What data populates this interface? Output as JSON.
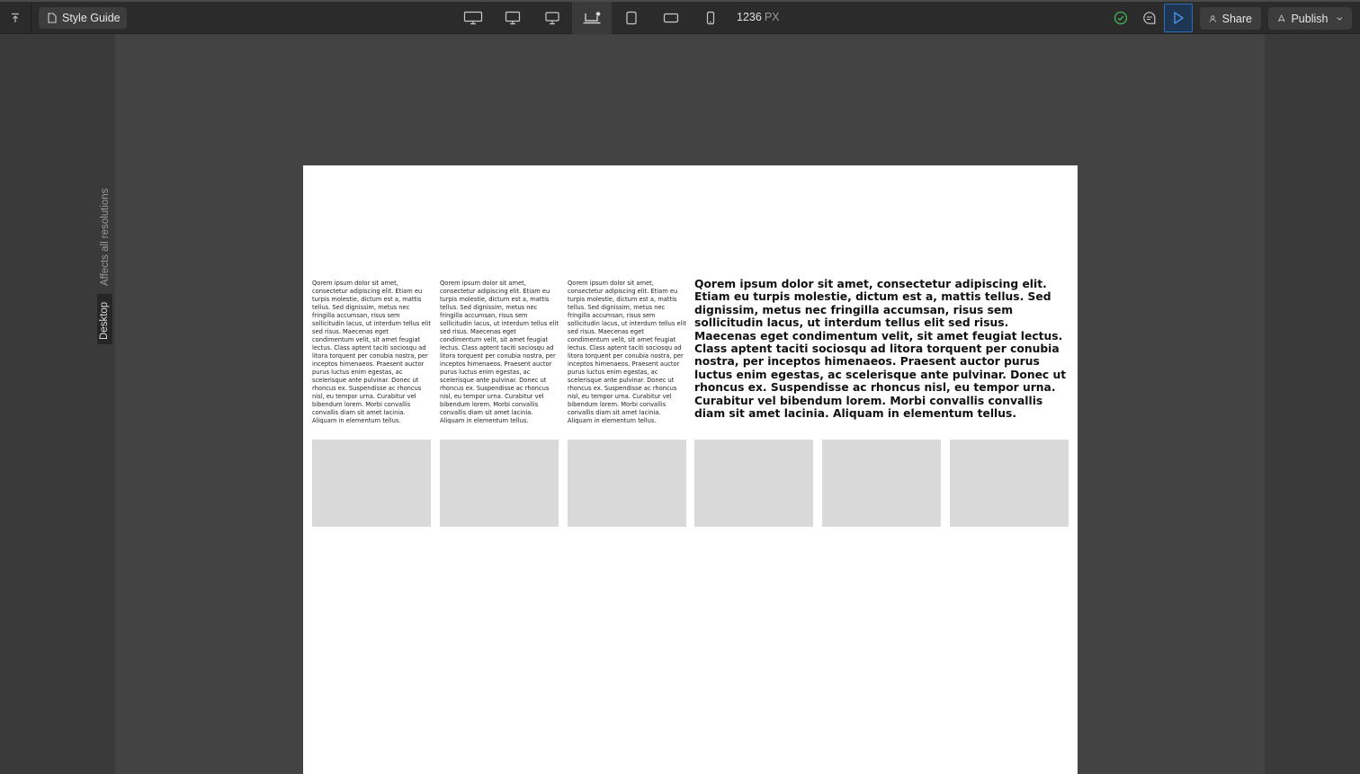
{
  "toolbar": {
    "page_tab_label": "Style Guide",
    "width_value": "1236",
    "width_unit": "PX",
    "share_label": "Share",
    "publish_label": "Publish",
    "devices": [
      "desktop-large-icon",
      "desktop-icon",
      "desktop-small-icon",
      "laptop-custom-icon",
      "tablet-portrait-icon",
      "tablet-landscape-icon",
      "mobile-icon"
    ],
    "active_device": "laptop-custom-icon",
    "status_color": "#3fb950",
    "accent_color": "#2f6fb8"
  },
  "breakpoint": {
    "affects_label": "Affects all resolutions",
    "current_label": "Desktop"
  },
  "canvas": {
    "columns": [
      {
        "text": "Qorem ipsum dolor sit amet, consectetur adipiscing elit. Etiam eu turpis molestie, dictum est a, mattis tellus. Sed dignissim, metus nec fringilla accumsan, risus sem sollicitudin lacus, ut interdum tellus elit sed risus. Maecenas eget condimentum velit, sit amet feugiat lectus. Class aptent taciti sociosqu ad litora torquent per conubia nostra, per inceptos himenaeos. Praesent auctor purus luctus enim egestas, ac scelerisque ante pulvinar. Donec ut rhoncus ex. Suspendisse ac rhoncus nisl, eu tempor urna. Curabitur vel bibendum lorem. Morbi convallis convallis diam sit amet lacinia. Aliquam in elementum tellus."
      },
      {
        "text": "Qorem ipsum dolor sit amet, consectetur adipiscing elit. Etiam eu turpis molestie, dictum est a, mattis tellus. Sed dignissim, metus nec fringilla accumsan, risus sem sollicitudin lacus, ut interdum tellus elit sed risus. Maecenas eget condimentum velit, sit amet feugiat lectus. Class aptent taciti sociosqu ad litora torquent per conubia nostra, per inceptos himenaeos. Praesent auctor purus luctus enim egestas, ac scelerisque ante pulvinar. Donec ut rhoncus ex. Suspendisse ac rhoncus nisl, eu tempor urna. Curabitur vel bibendum lorem. Morbi convallis convallis diam sit amet lacinia. Aliquam in elementum tellus."
      },
      {
        "text": "Qorem ipsum dolor sit amet, consectetur adipiscing elit. Etiam eu turpis molestie, dictum est a, mattis tellus. Sed dignissim, metus nec fringilla accumsan, risus sem sollicitudin lacus, ut interdum tellus elit sed risus. Maecenas eget condimentum velit, sit amet feugiat lectus. Class aptent taciti sociosqu ad litora torquent per conubia nostra, per inceptos himenaeos. Praesent auctor purus luctus enim egestas, ac scelerisque ante pulvinar. Donec ut rhoncus ex. Suspendisse ac rhoncus nisl, eu tempor urna. Curabitur vel bibendum lorem. Morbi convallis convallis diam sit amet lacinia. Aliquam in elementum tellus."
      }
    ],
    "heading_text": "Qorem ipsum dolor sit amet, consectetur adipiscing elit. Etiam eu turpis molestie, dictum est a, mattis tellus. Sed dignissim, metus nec fringilla accumsan, risus sem sollicitudin lacus, ut interdum tellus elit sed risus. Maecenas eget condimentum velit, sit amet feugiat lectus. Class aptent taciti sociosqu ad litora torquent per conubia nostra, per inceptos himenaeos. Praesent auctor purus luctus enim egestas, ac scelerisque ante pulvinar. Donec ut rhoncus ex. Suspendisse ac rhoncus nisl, eu tempor urna. Curabitur vel bibendum lorem. Morbi convallis convallis diam sit amet lacinia. Aliquam in elementum tellus.",
    "placeholder_color": "#d9d9d9"
  }
}
